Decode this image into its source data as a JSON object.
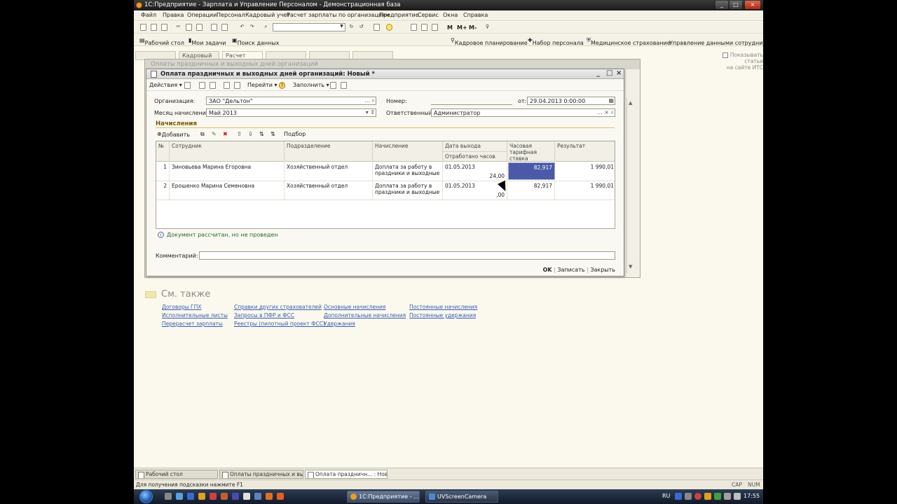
{
  "window": {
    "title": "1С:Предприятие - Зарплата и Управление Персоналом - Демонстрационная база",
    "controls": [
      "_",
      "□",
      "×"
    ]
  },
  "menu": [
    "Файл",
    "Правка",
    "Операции",
    "Персонал",
    "Кадровый учет",
    "Расчет зарплаты по организациям",
    "Предприятие",
    "Сервис",
    "Окна",
    "Справка"
  ],
  "toolbar1": {
    "m_buttons": [
      "M",
      "M+",
      "M-"
    ]
  },
  "toolbar2": {
    "left": [
      "Рабочий стол",
      "Мои задачи",
      "Поиск данных"
    ],
    "right": [
      "Кадровое планирование",
      "Набор персонала",
      "Медицинское страхование",
      "Управление данными сотрудника"
    ]
  },
  "bg_tabs": [
    "Кадровый",
    "Расчет"
  ],
  "its": {
    "line1": "Показывать статьи",
    "line2": "на сайте ИТС"
  },
  "bg_window_title": "Оплаты праздничных и выходных дней организаций",
  "dialog": {
    "title": "Оплата праздничных и выходных дней организаций: Новый *",
    "toolbar": {
      "actions": "Действия",
      "goto": "Перейти",
      "fill": "Заполнить"
    },
    "org_label": "Организация:",
    "org_value": "ЗАО \"Дельтон\"",
    "month_label": "Месяц начисления:",
    "month_value": "Май 2013",
    "number_label": "Номер:",
    "number_value": "",
    "date_label": "от:",
    "date_value": "29.04.2013  0:00:00",
    "resp_label": "Ответственный:",
    "resp_value": "Администратор",
    "section": "Начисления",
    "grid_toolbar": {
      "add": "Добавить",
      "pick": "Подбор"
    },
    "columns": {
      "num": "№",
      "employee": "Сотрудник",
      "department": "Подразделение",
      "accrual": "Начисление",
      "date": "Дата выхода",
      "hours": "Отработано часов",
      "rate": "Часовая тарифная ставка",
      "result": "Результат"
    },
    "rows": [
      {
        "num": "1",
        "employee": "Зиновьева Марина Егоровна",
        "department": "Хозяйственный отдел",
        "accrual1": "Доплата за работу в",
        "accrual2": "праздники и выходные",
        "date": "01.05.2013",
        "hours": "24,00",
        "rate": "82,917",
        "result": "1 990,01"
      },
      {
        "num": "2",
        "employee": "Ерошенко Марина Семеновна",
        "department": "Хозяйственный отдел",
        "accrual1": "Доплата за работу в",
        "accrual2": "праздники и выходные",
        "date": "01.05.2013",
        "hours": ",00",
        "rate": "82,917",
        "result": "1 990,01"
      }
    ],
    "info": "Документ рассчитан, но не проведен",
    "comment_label": "Комментарий:",
    "comment_value": "",
    "buttons": {
      "ok": "OK",
      "save": "Записать",
      "close": "Закрыть"
    }
  },
  "see_also": {
    "title": "См. также",
    "col1": [
      "Договоры ГПХ",
      "Исполнительные листы",
      "Перерасчет зарплаты"
    ],
    "col2": [
      "Справки других страхователей",
      "Запросы в ПФР и ФСС",
      "Реестры (пилотный проект ФСС)"
    ],
    "col3": [
      "Основные начисления",
      "Дополнительные начисления",
      "Удержания"
    ],
    "col4": [
      "Постоянные начисления",
      "Постоянные удержания"
    ]
  },
  "app_tasks": [
    "Рабочий стол",
    "Оплаты праздничных и вых...",
    "Оплата праздничн... : Новый *"
  ],
  "status": {
    "hint": "Для получения подсказки нажмите F1",
    "cap": "CAP",
    "num": "NUM"
  },
  "win_taskbar": {
    "btn1": "1С:Предприятие - ...",
    "btn2": "UVScreenCamera",
    "lang": "RU",
    "clock": "17:55"
  }
}
